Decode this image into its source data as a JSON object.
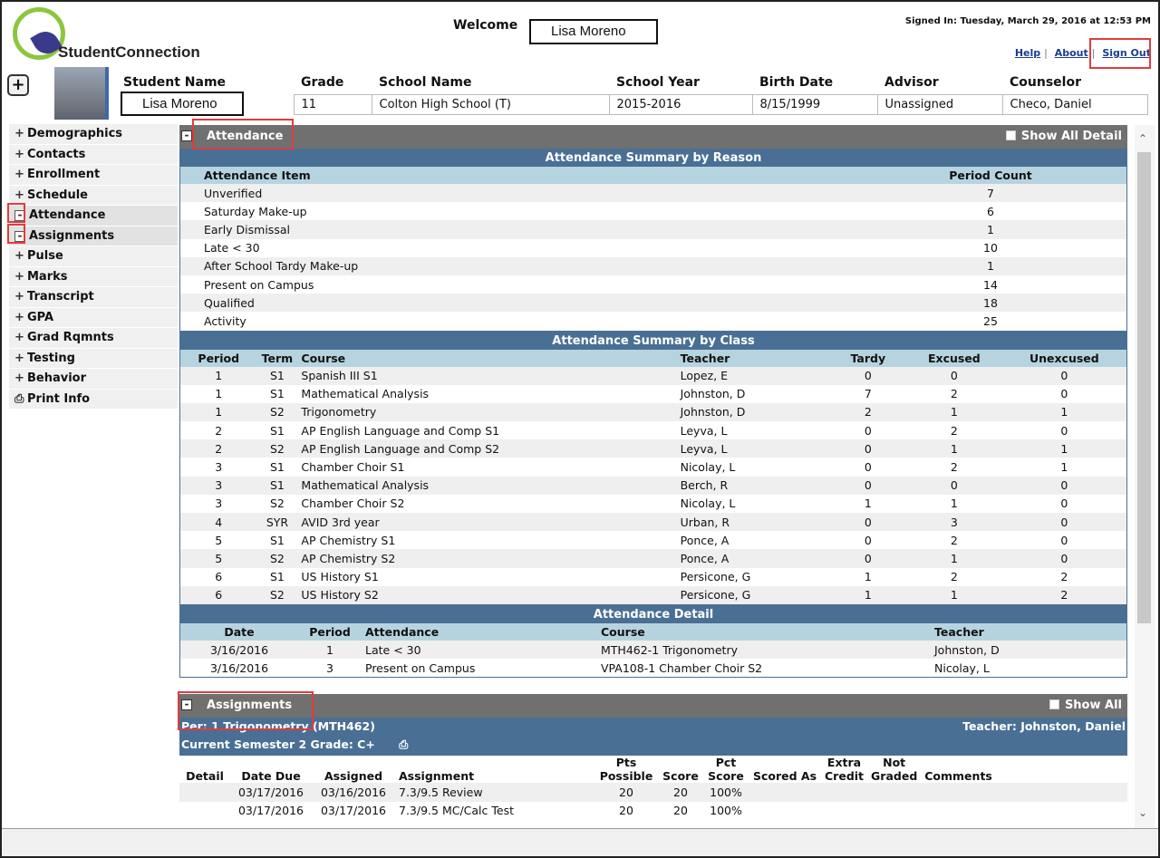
{
  "header": {
    "logo_text": "StudentConnection",
    "welcome": "Welcome",
    "user_name": "Lisa Moreno",
    "signed_in": "Signed In: Tuesday, March 29, 2016 at 12:53 PM",
    "links": [
      "Help",
      "About",
      "Sign Out"
    ]
  },
  "student": {
    "columns": [
      "Student Name",
      "Grade",
      "School Name",
      "School Year",
      "Birth Date",
      "Advisor",
      "Counselor"
    ],
    "values": {
      "name": "Lisa Moreno",
      "grade": "11",
      "school": "Colton High School (T)",
      "year": "2015-2016",
      "birth": "8/15/1999",
      "advisor": "Unassigned",
      "counselor": "Checo, Daniel"
    }
  },
  "sidebar": {
    "items": [
      {
        "label": "Demographics",
        "icon": "+"
      },
      {
        "label": "Contacts",
        "icon": "+"
      },
      {
        "label": "Enrollment",
        "icon": "+"
      },
      {
        "label": "Schedule",
        "icon": "+"
      },
      {
        "label": "Attendance",
        "icon": "-"
      },
      {
        "label": "Assignments",
        "icon": "-"
      },
      {
        "label": "Pulse",
        "icon": "+"
      },
      {
        "label": "Marks",
        "icon": "+"
      },
      {
        "label": "Transcript",
        "icon": "+"
      },
      {
        "label": "GPA",
        "icon": "+"
      },
      {
        "label": "Grad Rqmnts",
        "icon": "+"
      },
      {
        "label": "Testing",
        "icon": "+"
      },
      {
        "label": "Behavior",
        "icon": "+"
      }
    ],
    "print": "Print Info"
  },
  "attendance": {
    "title": "Attendance",
    "show_all": "Show All Detail",
    "by_reason_title": "Attendance Summary by Reason",
    "by_reason_cols": [
      "Attendance Item",
      "Period Count"
    ],
    "by_reason": [
      [
        "Unverified",
        "7"
      ],
      [
        "Saturday Make-up",
        "6"
      ],
      [
        "Early Dismissal",
        "1"
      ],
      [
        "Late < 30",
        "10"
      ],
      [
        "After School Tardy Make-up",
        "1"
      ],
      [
        "Present on Campus",
        "14"
      ],
      [
        "Qualified",
        "18"
      ],
      [
        "Activity",
        "25"
      ]
    ],
    "by_class_title": "Attendance Summary by Class",
    "by_class_cols": [
      "Period",
      "Term",
      "Course",
      "Teacher",
      "Tardy",
      "Excused",
      "Unexcused"
    ],
    "by_class": [
      [
        "1",
        "S1",
        "Spanish III S1",
        "Lopez, E",
        "0",
        "0",
        "0"
      ],
      [
        "1",
        "S1",
        "Mathematical Analysis",
        "Johnston, D",
        "7",
        "2",
        "0"
      ],
      [
        "1",
        "S2",
        "Trigonometry",
        "Johnston, D",
        "2",
        "1",
        "1"
      ],
      [
        "2",
        "S1",
        "AP English Language and Comp S1",
        "Leyva, L",
        "0",
        "2",
        "0"
      ],
      [
        "2",
        "S2",
        "AP English Language and Comp S2",
        "Leyva, L",
        "0",
        "1",
        "1"
      ],
      [
        "3",
        "S1",
        "Chamber Choir S1",
        "Nicolay, L",
        "0",
        "2",
        "1"
      ],
      [
        "3",
        "S1",
        "Mathematical Analysis",
        "Berch, R",
        "0",
        "0",
        "0"
      ],
      [
        "3",
        "S2",
        "Chamber Choir S2",
        "Nicolay, L",
        "1",
        "1",
        "0"
      ],
      [
        "4",
        "SYR",
        "AVID 3rd year",
        "Urban, R",
        "0",
        "3",
        "0"
      ],
      [
        "5",
        "S1",
        "AP Chemistry S1",
        "Ponce, A",
        "0",
        "2",
        "0"
      ],
      [
        "5",
        "S2",
        "AP Chemistry S2",
        "Ponce, A",
        "0",
        "1",
        "0"
      ],
      [
        "6",
        "S1",
        "US History S1",
        "Persicone, G",
        "1",
        "2",
        "2"
      ],
      [
        "6",
        "S2",
        "US History S2",
        "Persicone, G",
        "1",
        "1",
        "2"
      ]
    ],
    "detail_title": "Attendance Detail",
    "detail_cols": [
      "Date",
      "Period",
      "Attendance",
      "Course",
      "Teacher"
    ],
    "detail": [
      [
        "3/16/2016",
        "1",
        "Late < 30",
        "MTH462-1 Trigonometry",
        "Johnston, D"
      ],
      [
        "3/16/2016",
        "3",
        "Present on Campus",
        "VPA108-1 Chamber Choir S2",
        "Nicolay, L"
      ]
    ]
  },
  "assignments": {
    "title": "Assignments",
    "show_all": "Show All",
    "period": "Per: 1  Trigonometry (MTH462)",
    "teacher": "Teacher: Johnston, Daniel",
    "grade": "Current Semester 2 Grade: C+",
    "cols": [
      "Detail",
      "Date Due",
      "Assigned",
      "Assignment",
      "Pts Possible",
      "Score",
      "Pct Score",
      "Scored As",
      "Extra Credit",
      "Not Graded",
      "Comments"
    ],
    "rows": [
      [
        "",
        "03/17/2016",
        "03/16/2016",
        "7.3/9.5 Review",
        "20",
        "20",
        "100%",
        "",
        "",
        "",
        ""
      ],
      [
        "",
        "03/17/2016",
        "03/17/2016",
        "7.3/9.5 MC/Calc Test",
        "20",
        "20",
        "100%",
        "",
        "",
        "",
        ""
      ]
    ]
  }
}
